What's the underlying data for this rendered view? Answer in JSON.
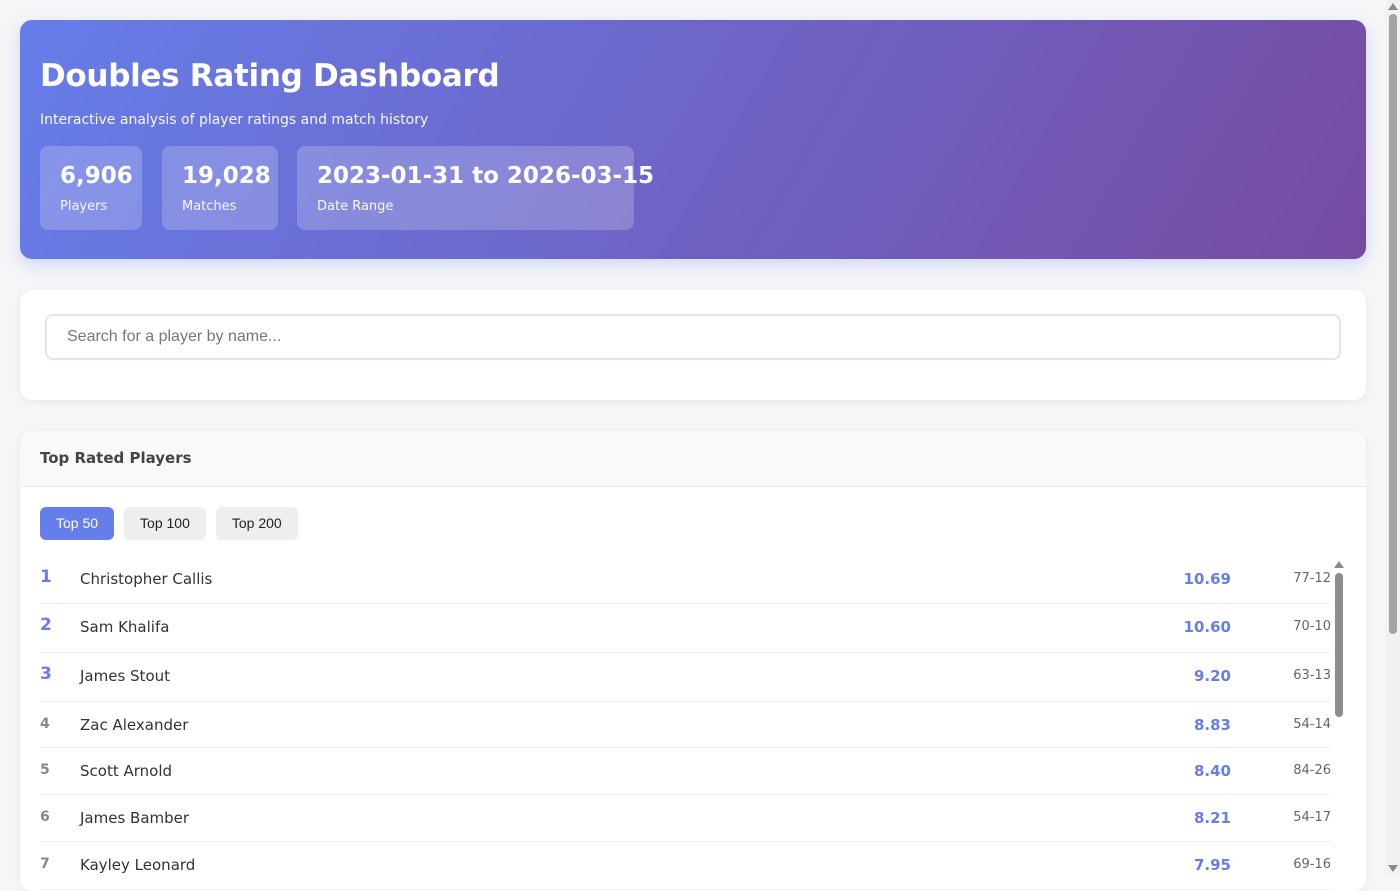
{
  "header": {
    "title": "Doubles Rating Dashboard",
    "subtitle": "Interactive analysis of player ratings and match history",
    "stats": [
      {
        "value": "6,906",
        "label": "Players"
      },
      {
        "value": "19,028",
        "label": "Matches"
      },
      {
        "value": "2023-01-31 to 2026-03-15",
        "label": "Date Range"
      }
    ]
  },
  "search": {
    "placeholder": "Search for a player by name..."
  },
  "top_players": {
    "title": "Top Rated Players",
    "tabs": [
      {
        "label": "Top 50",
        "active": true
      },
      {
        "label": "Top 100",
        "active": false
      },
      {
        "label": "Top 200",
        "active": false
      }
    ],
    "rows": [
      {
        "rank": "1",
        "name": "Christopher Callis",
        "rating": "10.69",
        "record": "77-12"
      },
      {
        "rank": "2",
        "name": "Sam Khalifa",
        "rating": "10.60",
        "record": "70-10"
      },
      {
        "rank": "3",
        "name": "James Stout",
        "rating": "9.20",
        "record": "63-13"
      },
      {
        "rank": "4",
        "name": "Zac Alexander",
        "rating": "8.83",
        "record": "54-14"
      },
      {
        "rank": "5",
        "name": "Scott Arnold",
        "rating": "8.40",
        "record": "84-26"
      },
      {
        "rank": "6",
        "name": "James Bamber",
        "rating": "8.21",
        "record": "54-17"
      },
      {
        "rank": "7",
        "name": "Kayley Leonard",
        "rating": "7.95",
        "record": "69-16"
      }
    ]
  },
  "colors": {
    "accent": "#667eea",
    "gradient_end": "#764ba2"
  }
}
